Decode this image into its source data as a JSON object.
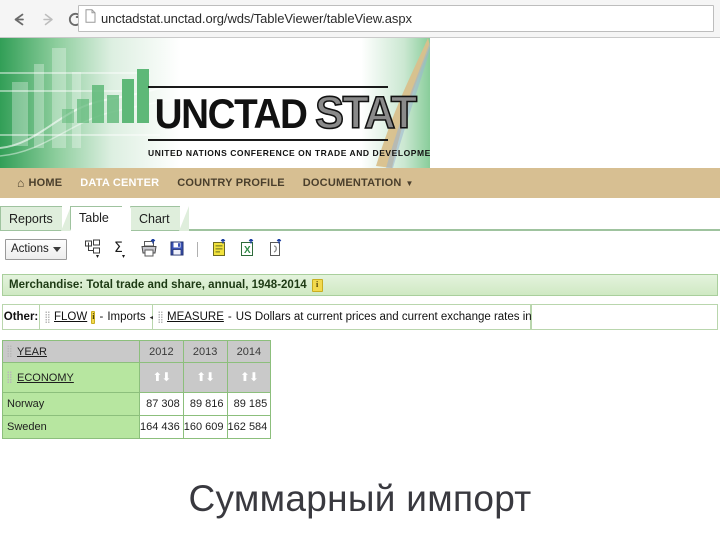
{
  "browser": {
    "back_icon": "back-arrow-icon",
    "forward_icon": "forward-arrow-icon",
    "reload_icon": "reload-icon",
    "home_icon": "home-icon",
    "page_icon": "page-document-icon",
    "url": "unctadstat.unctad.org/wds/TableViewer/tableView.aspx"
  },
  "banner": {
    "logo_unctad": "UNCTAD",
    "logo_stat": "STAT",
    "subtitle": "UNITED NATIONS CONFERENCE ON TRADE AND DEVELOPMENT",
    "bar_heights": [
      14,
      24,
      38,
      28,
      44,
      54
    ],
    "bar_color": "#5eb878",
    "green_accent": "#209648"
  },
  "top_nav": {
    "background": "#d7bf92",
    "active_color": "#ffffff",
    "items": [
      {
        "label": "HOME",
        "icon": "home-glyph-icon",
        "active": false,
        "caret": false
      },
      {
        "label": "DATA CENTER",
        "icon": "",
        "active": true,
        "caret": false
      },
      {
        "label": "COUNTRY PROFILE",
        "icon": "",
        "active": false,
        "caret": false
      },
      {
        "label": "DOCUMENTATION",
        "icon": "",
        "active": false,
        "caret": true
      }
    ]
  },
  "tabs": [
    {
      "label": "Reports",
      "active": false
    },
    {
      "label": "Table",
      "active": true
    },
    {
      "label": "Chart",
      "active": false
    }
  ],
  "toolbar": {
    "actions_label": "Actions",
    "actions_caret_icon": "chevron-down-icon",
    "icons": [
      {
        "name": "layout-dimensions-icon",
        "title": "Layout"
      },
      {
        "name": "sigma-summation-icon",
        "title": "Summation"
      },
      {
        "name": "printer-icon",
        "title": "Print"
      },
      {
        "name": "save-disk-icon",
        "title": "Save"
      },
      {
        "name": "download-csv-icon",
        "title": "Download CSV"
      },
      {
        "name": "download-excel-icon",
        "title": "Download Excel"
      },
      {
        "name": "download-pdf-icon",
        "title": "Download PDF"
      }
    ]
  },
  "dataset": {
    "title": "Merchandise: Total trade and share, annual, 1948-2014",
    "info_badge": "i"
  },
  "filters": {
    "other_label": "Other:",
    "flow": {
      "key": "FLOW",
      "info_badge": "i",
      "separator": "-",
      "value": "Imports",
      "pager_icon": "left-right-pager-icon"
    },
    "measure": {
      "key": "MEASURE",
      "separator": "-",
      "value": "US Dollars at current prices and current exchange rates in millions"
    }
  },
  "table": {
    "dim_year_label": "YEAR",
    "dim_economy_label": "ECONOMY",
    "grip_icon": "drag-grip-icon",
    "sort_icon": "sort-up-down-icon",
    "years": [
      "2012",
      "2013",
      "2014"
    ],
    "rows": [
      {
        "economy": "Norway",
        "values": [
          "87 308",
          "89 816",
          "89 185"
        ]
      },
      {
        "economy": "Sweden",
        "values": [
          "164 436",
          "160 609",
          "162 584"
        ]
      }
    ]
  },
  "caption": {
    "text": "Суммарный импорт"
  }
}
